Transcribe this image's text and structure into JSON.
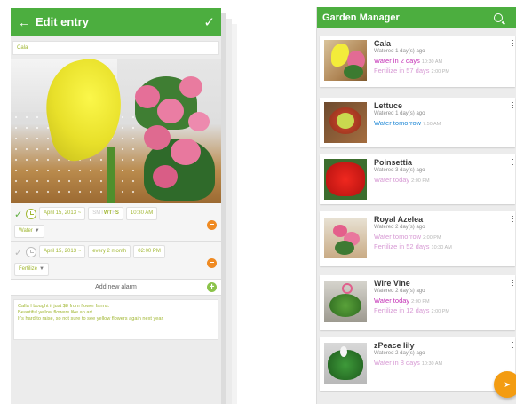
{
  "edit": {
    "title": "Edit entry",
    "name_value": "Cala",
    "alarms": [
      {
        "date": "April 15, 2013 ~",
        "days": {
          "dim_before": "SMT",
          "active": "WT",
          "dim_mid": "F",
          "active2": "S"
        },
        "time": "10:30 AM",
        "action": "Water",
        "enabled": true
      },
      {
        "date": "April 15, 2013 ~",
        "repeat": "every 2 month",
        "time": "02:00 PM",
        "action": "Fertilize",
        "enabled": false
      }
    ],
    "add_alarm_label": "Add new alarm",
    "notes": [
      "Calla I bought it just $8 from flower farms.",
      "Beautiful yellow flowers like an art.",
      "It's hard to raise, so not sure to see yellow flowers again next year."
    ]
  },
  "garden": {
    "title": "Garden Manager",
    "plants": [
      {
        "name": "Cala",
        "watered": "Watered 1 day(s) ago",
        "lines": [
          {
            "text": "Water in 2 days",
            "time": "10:30 AM",
            "color": "#c42fb5"
          },
          {
            "text": "Fertilize in 57 days",
            "time": "2:00 PM",
            "color": "#d79ad4"
          }
        ]
      },
      {
        "name": "Lettuce",
        "watered": "Watered 1 day(s) ago",
        "lines": [
          {
            "text": "Water tomorrow",
            "time": "7:50 AM",
            "color": "#1f88d6"
          }
        ]
      },
      {
        "name": "Poinsettia",
        "watered": "Watered 3 day(s) ago",
        "lines": [
          {
            "text": "Water today",
            "time": "2:00 PM",
            "color": "#d79ad4"
          }
        ]
      },
      {
        "name": "Royal Azelea",
        "watered": "Watered 2 day(s) ago",
        "lines": [
          {
            "text": "Water tomorrow",
            "time": "2:00 PM",
            "color": "#d79ad4"
          },
          {
            "text": "Fertilize in 52 days",
            "time": "10:30 AM",
            "color": "#d79ad4"
          }
        ]
      },
      {
        "name": "Wire Vine",
        "watered": "Watered 2 day(s) ago",
        "lines": [
          {
            "text": "Water today",
            "time": "2:00 PM",
            "color": "#c42fb5"
          },
          {
            "text": "Fertilize in 12 days",
            "time": "2:00 PM",
            "color": "#d79ad4"
          }
        ]
      },
      {
        "name": "zPeace lily",
        "watered": "Watered 2 day(s) ago",
        "lines": [
          {
            "text": "Water in 8 days",
            "time": "10:30 AM",
            "color": "#d79ad4"
          }
        ]
      }
    ]
  },
  "colors": {
    "appbar": "#4cae3f",
    "accent_text": "#a1b733",
    "fab": "#f39c12",
    "remove": "#ef8a22",
    "add": "#8bc34a"
  },
  "icons": [
    "back-arrow-icon",
    "check-icon",
    "clock-icon",
    "search-icon",
    "more-vert-icon",
    "add-icon",
    "remove-icon",
    "share-icon"
  ]
}
